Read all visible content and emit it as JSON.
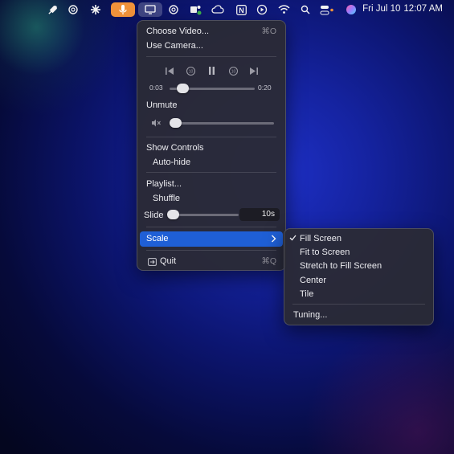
{
  "menubar": {
    "icons": [
      {
        "name": "rocket-icon",
        "glyph": "🚀"
      },
      {
        "name": "openai-icon",
        "glyph": "⊛"
      },
      {
        "name": "claude-icon",
        "glyph": "✳"
      },
      {
        "name": "microphone-icon",
        "glyph": "🎙"
      },
      {
        "name": "display-icon",
        "glyph": "▭"
      },
      {
        "name": "chatgpt-icon",
        "glyph": "⊛"
      },
      {
        "name": "teams-icon",
        "glyph": "⬢"
      },
      {
        "name": "creative-cloud-icon",
        "glyph": "∞"
      },
      {
        "name": "notion-icon",
        "glyph": "N"
      },
      {
        "name": "play-circle-icon",
        "glyph": "⏵"
      },
      {
        "name": "wifi-icon",
        "glyph": "≋"
      },
      {
        "name": "spotlight-search-icon",
        "glyph": "⌕"
      },
      {
        "name": "control-center-icon",
        "glyph": "☰"
      },
      {
        "name": "siri-icon",
        "glyph": "●"
      }
    ],
    "date": "Fri Jul 10",
    "time": "12:07 AM"
  },
  "menu": {
    "choose_video": "Choose Video...",
    "choose_video_shortcut": "⌘O",
    "use_camera": "Use Camera...",
    "current_time": "0:03",
    "total_time": "0:20",
    "progress": 0.15,
    "unmute": "Unmute",
    "volume": 0.05,
    "show_controls": "Show Controls",
    "auto_hide": "Auto-hide",
    "playlist": "Playlist...",
    "shuffle": "Shuffle",
    "slide": "Slide",
    "slide_value": "10s",
    "slide_level": 0.05,
    "scale": "Scale",
    "quit": "Quit",
    "quit_shortcut": "⌘Q"
  },
  "submenu": {
    "fill_screen": "Fill Screen",
    "fit_to_screen": "Fit to Screen",
    "stretch": "Stretch to Fill Screen",
    "center": "Center",
    "tile": "Tile",
    "tuning": "Tuning...",
    "selected": "Fill Screen"
  },
  "colors": {
    "accent": "#1f5fd6",
    "mic_active": "#f0923a"
  }
}
